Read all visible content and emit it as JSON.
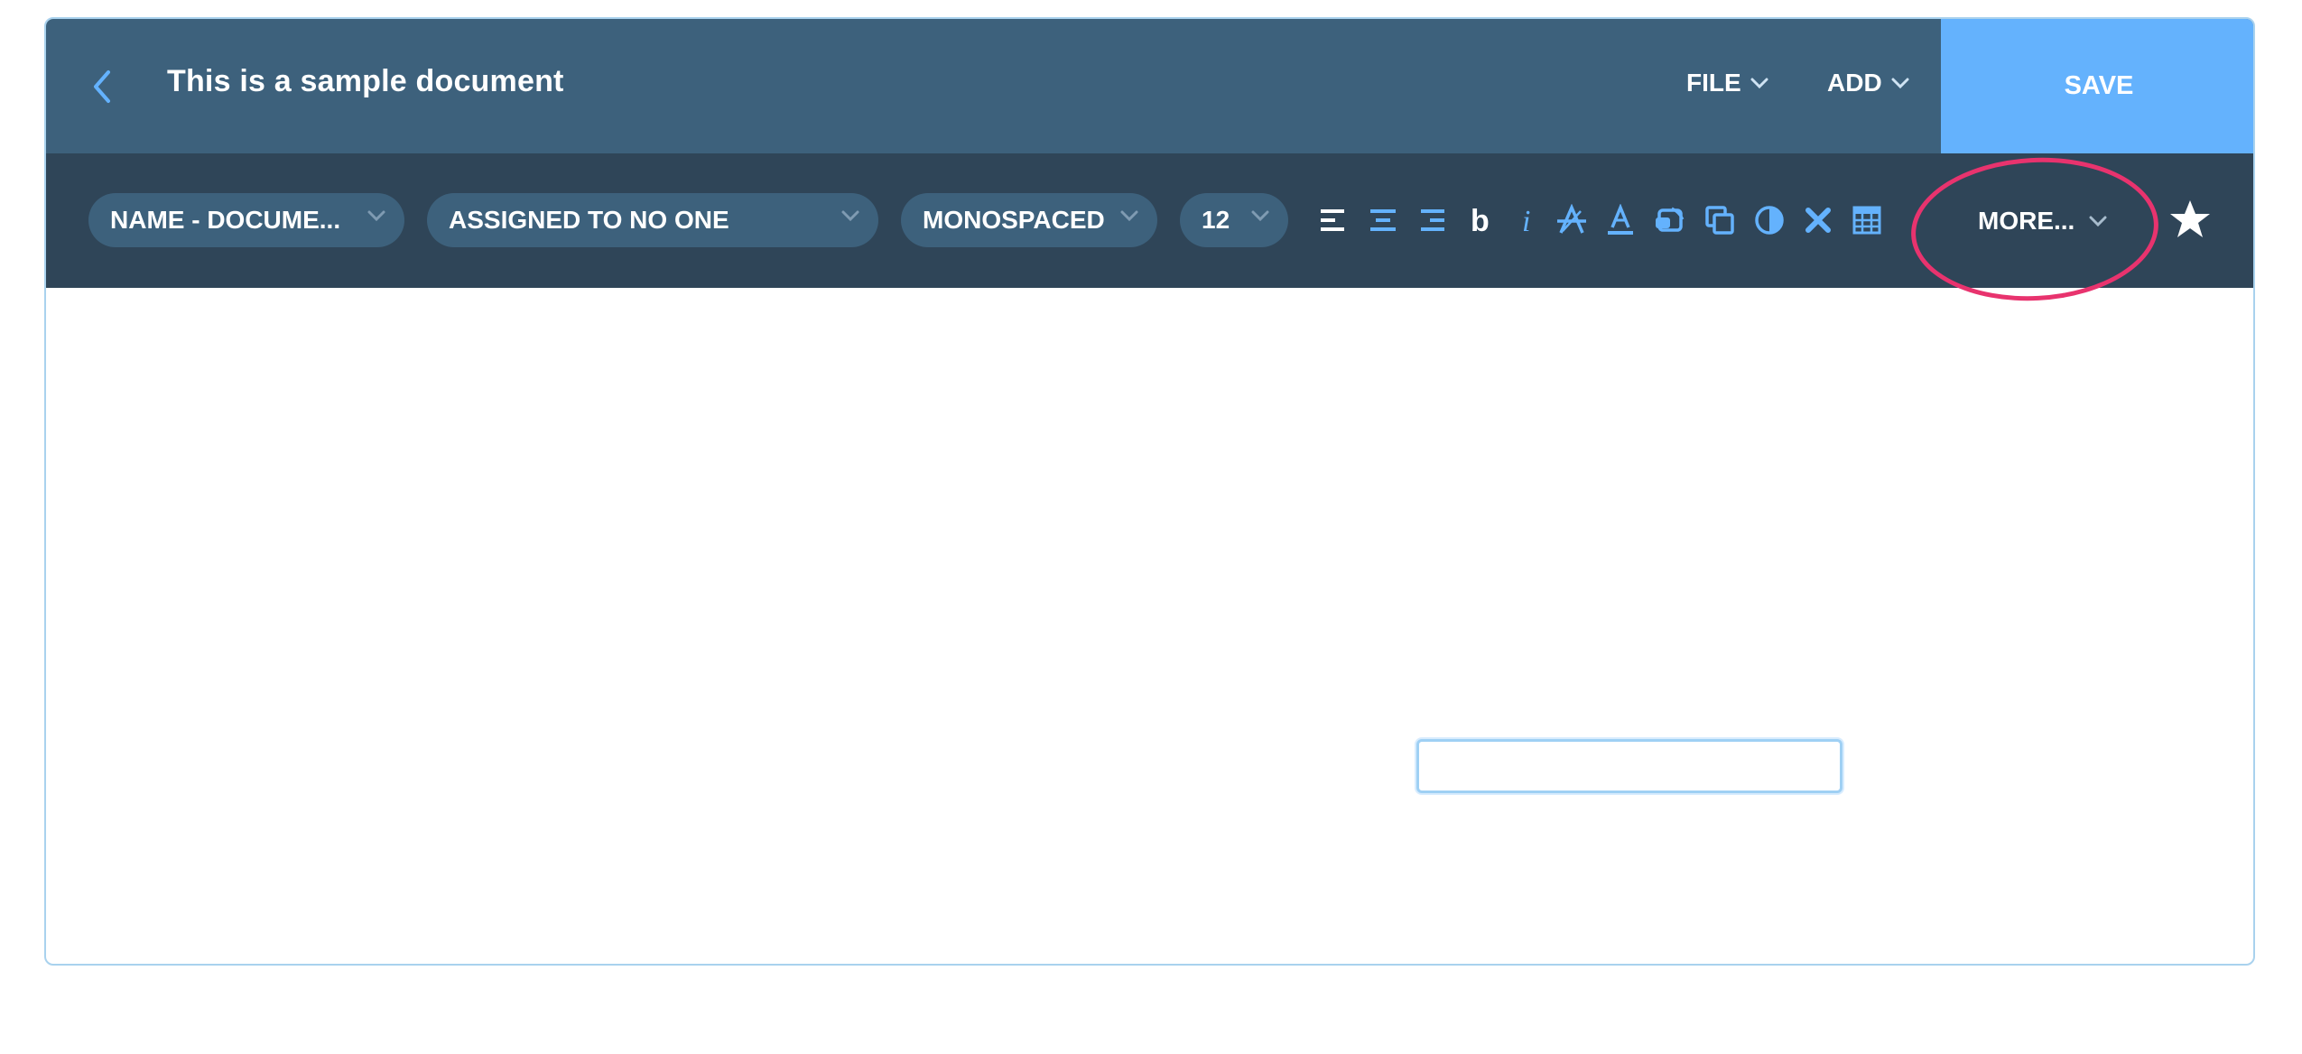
{
  "header": {
    "title": "This is a sample document",
    "menus": [
      {
        "label": "FILE"
      },
      {
        "label": "ADD"
      }
    ],
    "save_label": "SAVE"
  },
  "toolbar": {
    "name_select": "NAME - DOCUME...",
    "assignee_select": "ASSIGNED TO NO ONE",
    "font_select": "MONOSPACED",
    "size_select": "12",
    "tools": [
      "align-left-icon",
      "align-center-icon",
      "align-right-icon",
      "bold-icon",
      "italic-icon",
      "strikethrough-icon",
      "text-color-icon",
      "erase-format-icon",
      "copy-icon",
      "contrast-icon",
      "clear-icon",
      "table-icon"
    ],
    "more_label": "MORE..."
  },
  "editor": {
    "input_value": ""
  },
  "colors": {
    "header_bg": "#3d617c",
    "toolbar_bg": "#2f4558",
    "accent": "#64b2fd",
    "highlight": "#e8336e"
  }
}
